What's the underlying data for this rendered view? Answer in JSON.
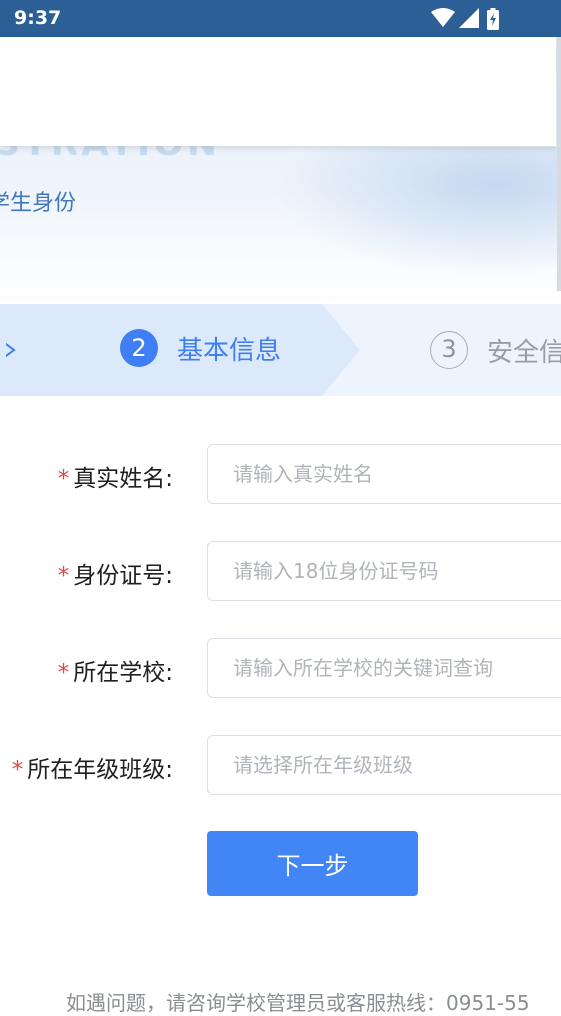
{
  "status_bar": {
    "time": "9:37"
  },
  "banner": {
    "english_title": "STRATION",
    "subtitle": "学生身份"
  },
  "steps": [
    {
      "number": "2",
      "label": "基本信息",
      "active": true
    },
    {
      "number": "3",
      "label": "安全信",
      "active": false
    }
  ],
  "form": {
    "fields": [
      {
        "label": "真实姓名:",
        "placeholder": "请输入真实姓名",
        "required": true
      },
      {
        "label": "身份证号:",
        "placeholder": "请输入18位身份证号码",
        "required": true
      },
      {
        "label": "所在学校:",
        "placeholder": "请输入所在学校的关键词查询",
        "required": true
      },
      {
        "label": "所在年级班级:",
        "placeholder": "请选择所在年级班级",
        "required": true
      }
    ],
    "required_mark": "*",
    "next_button": "下一步"
  },
  "footer": {
    "help_text": "如遇问题，请咨询学校管理员或客服热线：0951-55"
  },
  "colors": {
    "primary": "#4285f4",
    "status_bar": "#2c5f95",
    "required": "#e04848"
  }
}
